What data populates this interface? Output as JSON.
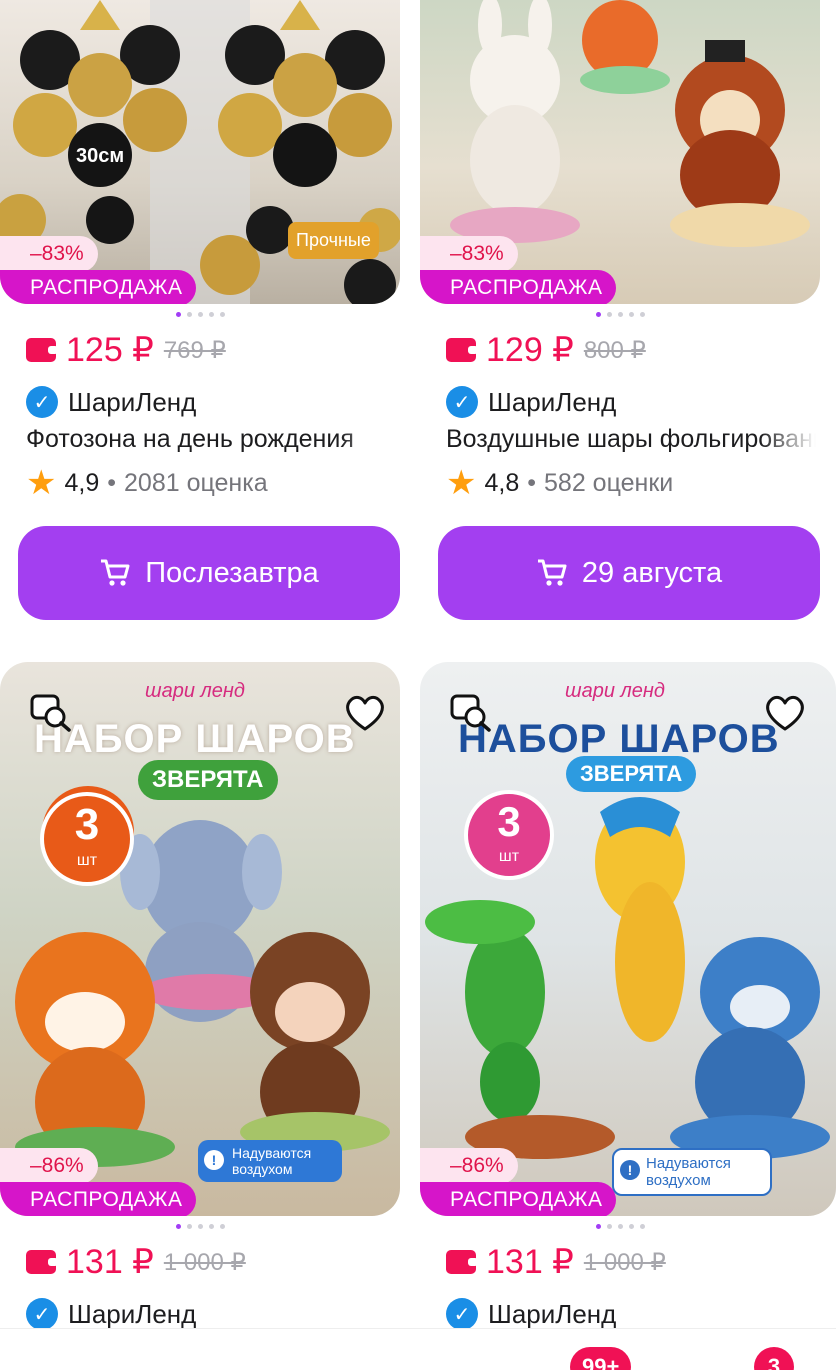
{
  "products": [
    {
      "discount": "–83%",
      "sale_label": "РАСПРОДАЖА",
      "image_badge": "Прочные",
      "image_caption": "30см",
      "price": "125 ₽",
      "old_price": "769 ₽",
      "seller": "ШариЛенд",
      "title": "Фотозона на день рождения",
      "rating": "4,9",
      "reviews": "2081 оценка",
      "button": "Послезавтра"
    },
    {
      "discount": "–83%",
      "sale_label": "РАСПРОДАЖА",
      "price": "129 ₽",
      "old_price": "800 ₽",
      "seller": "ШариЛенд",
      "title": "Воздушные шары фольгированные",
      "rating": "4,8",
      "reviews": "582 оценки",
      "button": "29 августа"
    },
    {
      "discount": "–86%",
      "sale_label": "РАСПРОДАЖА",
      "image_brand": "шари ленд",
      "image_heading": "НАБОР ШАРОВ",
      "image_sub": "ЗВЕРЯТА",
      "image_count": "3",
      "image_count_unit": "шт",
      "image_note": "Надуваются воздухом",
      "price": "131 ₽",
      "old_price": "1 000 ₽",
      "seller": "ШариЛенд"
    },
    {
      "discount": "–86%",
      "sale_label": "РАСПРОДАЖА",
      "image_brand": "шари ленд",
      "image_heading": "НАБОР ШАРОВ",
      "image_sub": "ЗВЕРЯТА",
      "image_count": "3",
      "image_count_unit": "шт",
      "image_note": "Надуваются воздухом",
      "price": "131 ₽",
      "old_price": "1 000 ₽",
      "seller": "ШариЛенд"
    }
  ],
  "nav_badges": [
    "99+",
    "3"
  ],
  "colors": {
    "accent": "#a33ff0",
    "price": "#f01155",
    "sale": "#d615c9",
    "discount_bg": "#fde4ef",
    "star": "#ff9e0e",
    "verified": "#1a8ee6"
  },
  "icons": [
    "cart-icon",
    "verified-icon",
    "star-icon",
    "similar-search-icon",
    "heart-icon",
    "wallet-icon"
  ]
}
